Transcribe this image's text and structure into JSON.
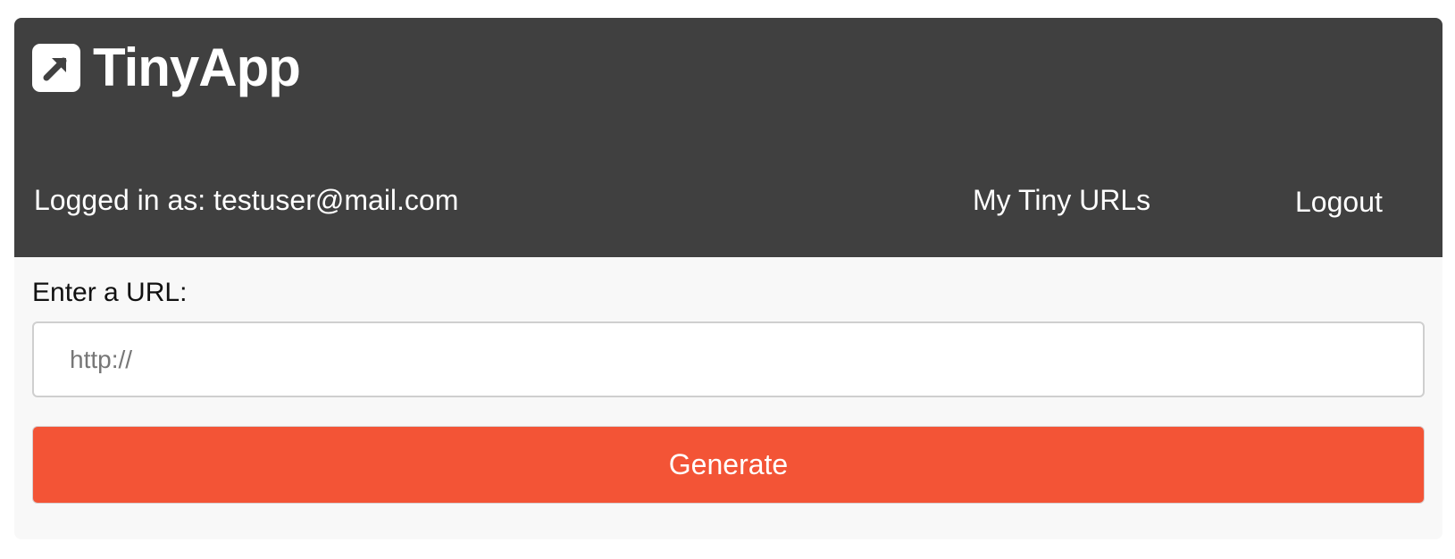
{
  "header": {
    "brand": {
      "title": "TinyApp",
      "icon": "arrow-up-right-square-icon"
    },
    "login_info": "Logged in as: testuser@mail.com",
    "nav": {
      "my_urls_label": "My Tiny URLs",
      "logout_label": "Logout"
    }
  },
  "form": {
    "label": "Enter a URL:",
    "url_input": {
      "value": "",
      "placeholder": "http://"
    },
    "submit_label": "Generate"
  },
  "colors": {
    "header_background": "#404040",
    "page_background": "#f8f8f8",
    "button_accent": "#f35436",
    "text_light": "#ffffff"
  }
}
